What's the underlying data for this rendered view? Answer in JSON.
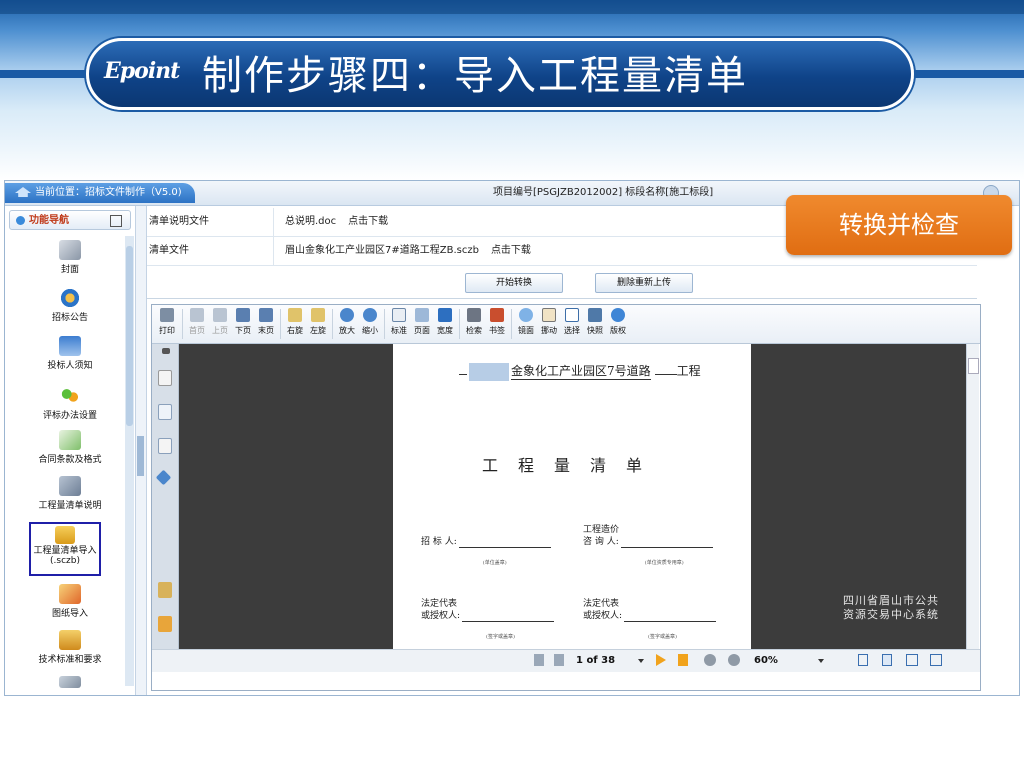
{
  "slide": {
    "logo": "Epoint",
    "title": "制作步骤四：导入工程量清单"
  },
  "topbar": {
    "breadcrumb": "当前位置：招标文件制作（V5.0)",
    "project_info": "项目编号[PSGJZB2012002]  标段名称[施工标段]"
  },
  "sidebar": {
    "header": "功能导航",
    "items": [
      {
        "label": "封面",
        "icon": "cover-icon"
      },
      {
        "label": "招标公告",
        "icon": "announcement-icon"
      },
      {
        "label": "投标人须知",
        "icon": "bidder-notice-icon"
      },
      {
        "label": "评标办法设置",
        "icon": "evaluation-settings-icon"
      },
      {
        "label": "合同条款及格式",
        "icon": "contract-terms-icon"
      },
      {
        "label": "工程量清单说明",
        "icon": "bill-description-icon"
      },
      {
        "label": "工程量清单导入\n(.sczb)",
        "icon": "bill-import-icon",
        "active": true
      },
      {
        "label": "图纸导入",
        "icon": "drawing-import-icon"
      },
      {
        "label": "技术标准和要求",
        "icon": "tech-standards-icon"
      }
    ]
  },
  "files": {
    "rows": [
      {
        "label": "清单说明文件",
        "file": "总说明.doc",
        "download": "点击下载"
      },
      {
        "label": "清单文件",
        "file": "眉山金象化工产业园区7#道路工程ZB.sczb",
        "download": "点击下载"
      }
    ],
    "buttons": {
      "convert": "开始转换",
      "delete_reupload": "删除重新上传"
    }
  },
  "callout": "转换并检查",
  "viewer": {
    "toolbar": [
      {
        "label": "打印",
        "icon": "print-icon"
      },
      {
        "label": "首页",
        "icon": "first-page-icon",
        "disabled": true
      },
      {
        "label": "上页",
        "icon": "prev-page-icon",
        "disabled": true
      },
      {
        "label": "下页",
        "icon": "next-page-icon"
      },
      {
        "label": "末页",
        "icon": "last-page-icon"
      },
      {
        "label": "右旋",
        "icon": "rotate-right-icon"
      },
      {
        "label": "左旋",
        "icon": "rotate-left-icon"
      },
      {
        "label": "放大",
        "icon": "zoom-in-icon"
      },
      {
        "label": "缩小",
        "icon": "zoom-out-icon"
      },
      {
        "label": "标准",
        "icon": "actual-size-icon"
      },
      {
        "label": "页面",
        "icon": "fit-page-icon"
      },
      {
        "label": "宽度",
        "icon": "fit-width-icon"
      },
      {
        "label": "检索",
        "icon": "search-icon"
      },
      {
        "label": "书签",
        "icon": "bookmark-icon"
      },
      {
        "label": "镜面",
        "icon": "magnifier-icon"
      },
      {
        "label": "挪动",
        "icon": "hand-icon"
      },
      {
        "label": "选择",
        "icon": "select-text-icon"
      },
      {
        "label": "快照",
        "icon": "snapshot-icon"
      },
      {
        "label": "版权",
        "icon": "copyright-icon"
      }
    ],
    "document": {
      "header_prefix": "",
      "header_project": "金象化工产业园区7号道路",
      "header_suffix": "工程",
      "title": "工程量清单",
      "tenderer_label": "招 标 人:",
      "tenderer_note": "(单位盖章)",
      "consultant_label_1": "工程造价",
      "consultant_label_2": "咨 询 人:",
      "consultant_note": "(单位资质专用章)",
      "legal_label_1": "法定代表",
      "legal_label_2": "或授权人:",
      "legal_note": "(签字或盖章)",
      "legal2_label_1": "法定代表",
      "legal2_label_2": "或授权人:",
      "legal2_note": "(签字或盖章)"
    },
    "watermark_line1": "四川省眉山市公共",
    "watermark_line2": "资源交易中心系统",
    "status": {
      "page": "1 of 38",
      "zoom": "60%"
    }
  }
}
